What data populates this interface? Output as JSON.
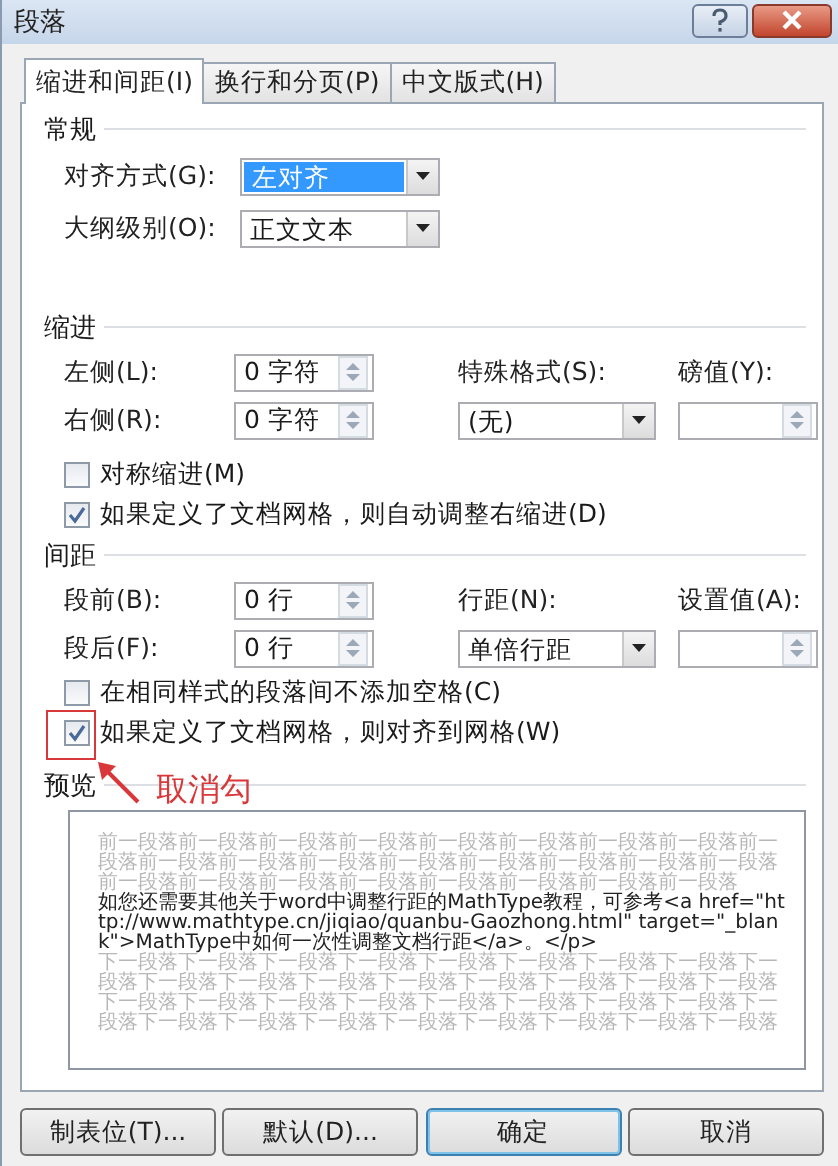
{
  "window": {
    "title": "段落"
  },
  "tabs": [
    {
      "label": "缩进和间距(I)",
      "selected": true
    },
    {
      "label": "换行和分页(P)",
      "selected": false
    },
    {
      "label": "中文版式(H)",
      "selected": false
    }
  ],
  "general": {
    "heading": "常规",
    "fields": [
      {
        "label": "对齐方式(G):",
        "value": "左对齐",
        "selected": true
      },
      {
        "label": "大纲级别(O):",
        "value": "正文文本",
        "selected": false
      }
    ]
  },
  "indent": {
    "heading": "缩进",
    "left": {
      "label": "左侧(L):",
      "value": "0 字符"
    },
    "right": {
      "label": "右侧(R):",
      "value": "0 字符"
    },
    "special": {
      "label": "特殊格式(S):",
      "value": "(无)"
    },
    "by": {
      "label": "磅值(Y):"
    },
    "checkboxes": [
      {
        "label": "对称缩进(M)",
        "checked": false
      },
      {
        "label": "如果定义了文档网格，则自动调整右缩进(D)",
        "checked": true
      }
    ]
  },
  "spacing": {
    "heading": "间距",
    "before": {
      "label": "段前(B):",
      "value": "0 行"
    },
    "after": {
      "label": "段后(F):",
      "value": "0 行"
    },
    "line": {
      "label": "行距(N):",
      "value": "单倍行距"
    },
    "at": {
      "label": "设置值(A):"
    },
    "checkboxes": [
      {
        "label": "在相同样式的段落间不添加空格(C)",
        "checked": false
      },
      {
        "label": "如果定义了文档网格，则对齐到网格(W)",
        "checked": true
      }
    ]
  },
  "annotation": {
    "text": "取消勾"
  },
  "preview": {
    "heading": "预览",
    "paragraphs": [
      {
        "kind": "previous",
        "text": "前一段落前一段落前一段落前一段落前一段落前一段落前一段落前一段落前一段落前一段落前一段落前一段落前一段落前一段落前一段落前一段落前一段落前一段落前一段落前一段落前一段落前一段落前一段落前一段落前一段落"
      },
      {
        "kind": "current",
        "text": "如您还需要其他关于word中调整行距的MathType教程，可参考<a href=\"http://www.mathtype.cn/jiqiao/quanbu-Gaozhong.html\" target=\"_blank\">MathType中如何一次性调整文档行距</a>。</p>"
      },
      {
        "kind": "next",
        "text": "下一段落下一段落下一段落下一段落下一段落下一段落下一段落下一段落下一段落下一段落下一段落下一段落下一段落下一段落下一段落下一段落下一段落下一段落下一段落下一段落下一段落下一段落下一段落下一段落下一段落下一段落下一段落下一段落下一段落下一段落下一段落下一段落下一段落下一段落"
      }
    ]
  },
  "buttons": [
    {
      "label": "制表位(T)...",
      "default": false
    },
    {
      "label": "默认(D)...",
      "default": false
    },
    {
      "label": "确定",
      "default": true
    },
    {
      "label": "取消",
      "default": false
    }
  ]
}
